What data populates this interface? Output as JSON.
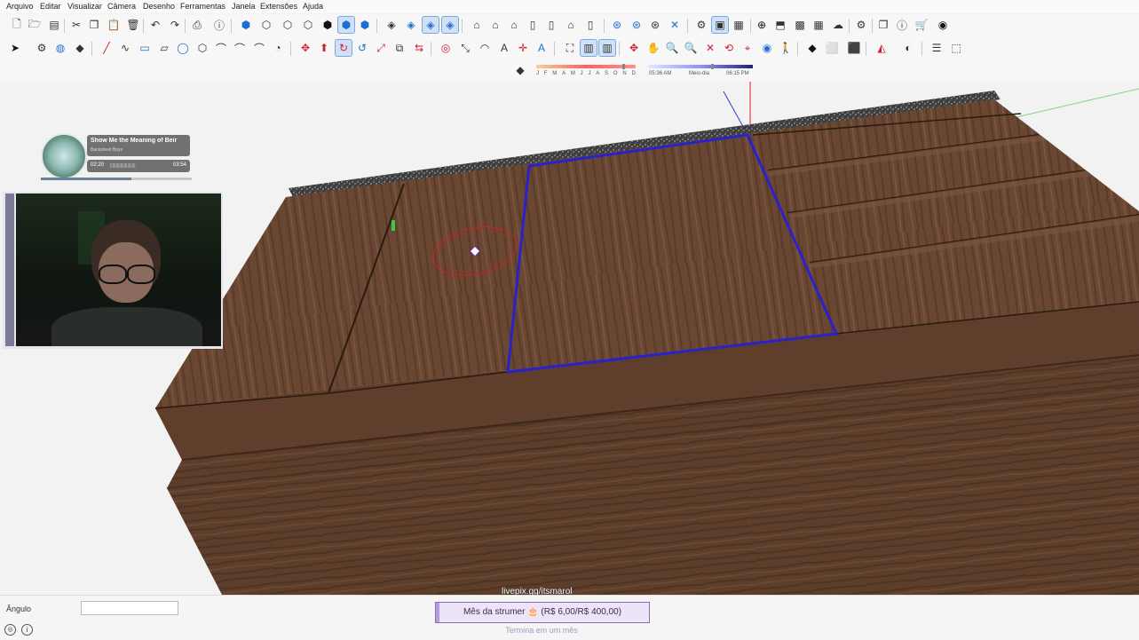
{
  "menu": [
    "Arquivo",
    "Editar",
    "Visualizar",
    "Câmera",
    "Desenho",
    "Ferramentas",
    "Janela",
    "Extensões",
    "Ajuda"
  ],
  "shadow": {
    "months": [
      "J",
      "F",
      "M",
      "A",
      "M",
      "J",
      "J",
      "A",
      "S",
      "O",
      "N",
      "D"
    ],
    "time_start": "05:36 AM",
    "time_mid": "Meio-dia",
    "time_end": "06:15 PM"
  },
  "music": {
    "title": "Show Me the Meaning of Beir",
    "artist": "Backstreet Boys",
    "elapsed": "02:20",
    "duration": "03:54",
    "progress": 0.6
  },
  "overlay": {
    "link": "livepix.gg/itsmarol",
    "goal_label": "Mês da strumer 🎂 (R$ 6,00/R$ 400,00)",
    "goal_sub": "Termina em um mês",
    "goal_progress": 0.015
  },
  "status": {
    "measure_label": "Ângulo",
    "measure_value": ""
  },
  "colors": {
    "selection": "#2a22c8",
    "wood_top": "#6d4a35",
    "wood_side": "#5a3b28",
    "accent_blue": "#1f6fd0"
  }
}
